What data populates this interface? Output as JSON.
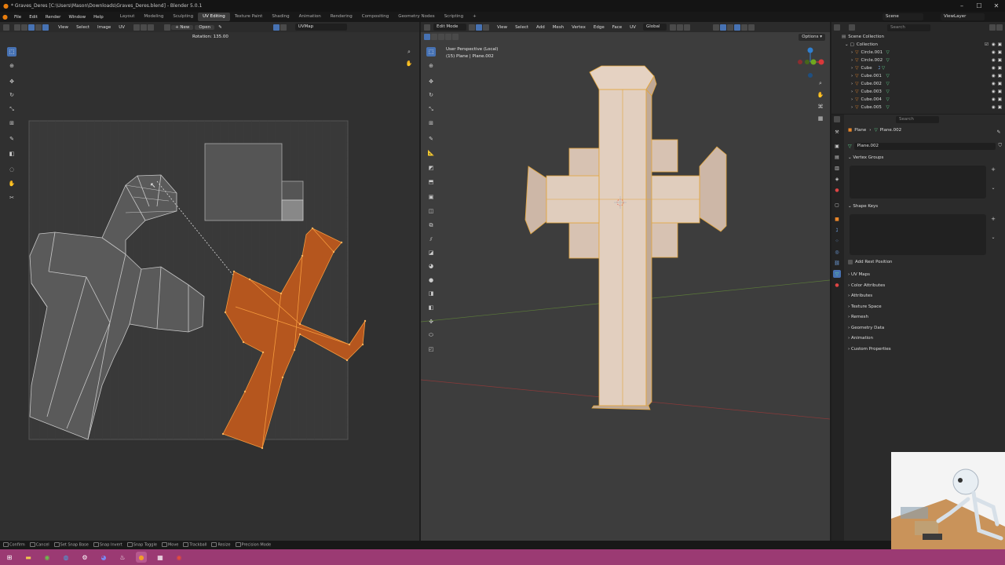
{
  "window": {
    "title": "* Graves_Deres [C:\\Users\\Mason\\Downloads\\Graves_Deres.blend] - Blender 5.0.1"
  },
  "menu": [
    "File",
    "Edit",
    "Render",
    "Window",
    "Help"
  ],
  "workspaces": [
    "Layout",
    "Modeling",
    "Sculpting",
    "UV Editing",
    "Texture Paint",
    "Shading",
    "Animation",
    "Rendering",
    "Compositing",
    "Geometry Nodes",
    "Scripting"
  ],
  "scene": {
    "name": "Scene",
    "view_layer": "ViewLayer"
  },
  "uv_editor": {
    "menus": [
      "View",
      "Select",
      "Image",
      "UV"
    ],
    "new_label": "New",
    "open_label": "Open",
    "uvmap": "UVMap",
    "rotation_readout": "Rotation: 135.00"
  },
  "viewport": {
    "mode": "Edit Mode",
    "menus": [
      "View",
      "Select",
      "Add",
      "Mesh",
      "Vertex",
      "Edge",
      "Face",
      "UV"
    ],
    "orientation": "Global",
    "options_label": "Options",
    "overlay_line1": "User Perspective (Local)",
    "overlay_line2": "(15) Plane | Plane.002"
  },
  "outliner": {
    "search_placeholder": "Search",
    "scene_collection": "Scene Collection",
    "collection": "Collection",
    "items": [
      "Circle.001",
      "Circle.002",
      "Cube",
      "Cube.001",
      "Cube.002",
      "Cube.003",
      "Cube.004",
      "Cube.005"
    ]
  },
  "properties": {
    "search_placeholder": "Search",
    "breadcrumb_object": "Plane",
    "breadcrumb_data": "Plane.002",
    "data_name": "Plane.002",
    "vertex_groups": "Vertex Groups",
    "shape_keys": "Shape Keys",
    "add_rest_position": "Add Rest Position",
    "collapsed_sections": [
      "UV Maps",
      "Color Attributes",
      "Attributes",
      "Texture Space",
      "Remesh",
      "Geometry Data",
      "Animation",
      "Custom Properties"
    ]
  },
  "statusbar": [
    "Confirm",
    "Cancel",
    "Set Snap Base",
    "Snap Invert",
    "Snap Toggle",
    "Move",
    "Trackball",
    "Resize",
    "Precision Mode"
  ],
  "colors": {
    "accent": "#4772b3",
    "selection": "#e8862a",
    "taskbar": "#9b3a73"
  }
}
